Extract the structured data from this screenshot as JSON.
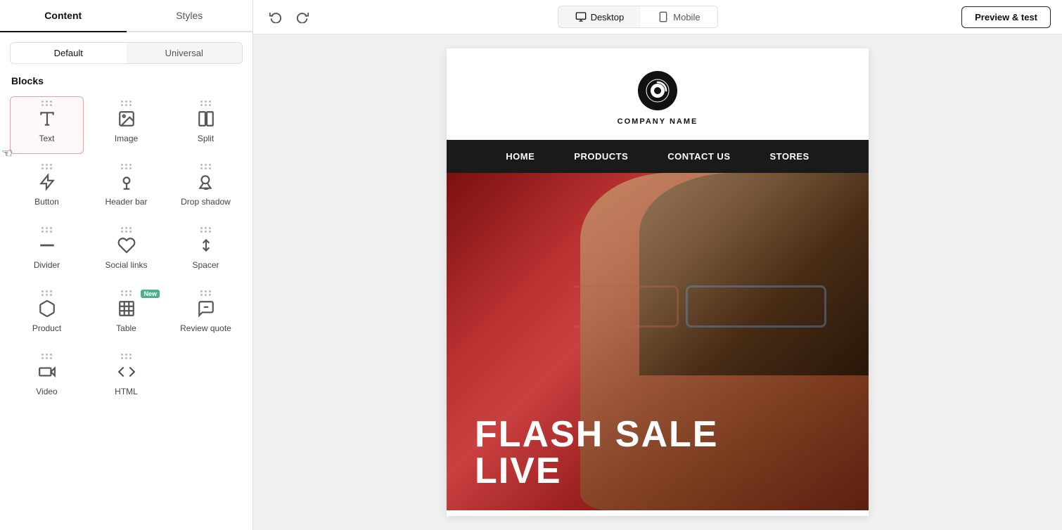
{
  "leftPanel": {
    "tabs": [
      {
        "id": "content",
        "label": "Content",
        "active": true
      },
      {
        "id": "styles",
        "label": "Styles",
        "active": false
      }
    ],
    "toggleButtons": [
      {
        "id": "default",
        "label": "Default",
        "active": true
      },
      {
        "id": "universal",
        "label": "Universal",
        "active": false
      }
    ],
    "blocksTitle": "Blocks",
    "blocks": [
      {
        "id": "text",
        "label": "Text",
        "icon": "text",
        "selected": true,
        "new": false
      },
      {
        "id": "image",
        "label": "Image",
        "icon": "image",
        "selected": false,
        "new": false
      },
      {
        "id": "split",
        "label": "Split",
        "icon": "split",
        "selected": false,
        "new": false
      },
      {
        "id": "button",
        "label": "Button",
        "icon": "button",
        "selected": false,
        "new": false
      },
      {
        "id": "header-bar",
        "label": "Header bar",
        "icon": "header-bar",
        "selected": false,
        "new": false
      },
      {
        "id": "drop-shadow",
        "label": "Drop shadow",
        "icon": "drop-shadow",
        "selected": false,
        "new": false
      },
      {
        "id": "divider",
        "label": "Divider",
        "icon": "divider",
        "selected": false,
        "new": false
      },
      {
        "id": "social-links",
        "label": "Social links",
        "icon": "social-links",
        "selected": false,
        "new": false
      },
      {
        "id": "spacer",
        "label": "Spacer",
        "icon": "spacer",
        "selected": false,
        "new": false
      },
      {
        "id": "product",
        "label": "Product",
        "icon": "product",
        "selected": false,
        "new": false
      },
      {
        "id": "table",
        "label": "Table",
        "icon": "table",
        "selected": false,
        "new": true
      },
      {
        "id": "review-quote",
        "label": "Review quote",
        "icon": "review-quote",
        "selected": false,
        "new": false
      },
      {
        "id": "video",
        "label": "Video",
        "icon": "video",
        "selected": false,
        "new": false
      },
      {
        "id": "html",
        "label": "HTML",
        "icon": "html",
        "selected": false,
        "new": false
      }
    ]
  },
  "toolbar": {
    "undoLabel": "↩",
    "redoLabel": "↪",
    "devices": [
      {
        "id": "desktop",
        "label": "Desktop",
        "active": true
      },
      {
        "id": "mobile",
        "label": "Mobile",
        "active": false
      }
    ],
    "previewLabel": "Preview & test"
  },
  "email": {
    "companyName": "COMPANY NAME",
    "nav": [
      "HOME",
      "PRODUCTS",
      "CONTACT US",
      "STORES"
    ],
    "hero": {
      "line1": "FLASH SALE",
      "line2": "LIVE"
    }
  }
}
